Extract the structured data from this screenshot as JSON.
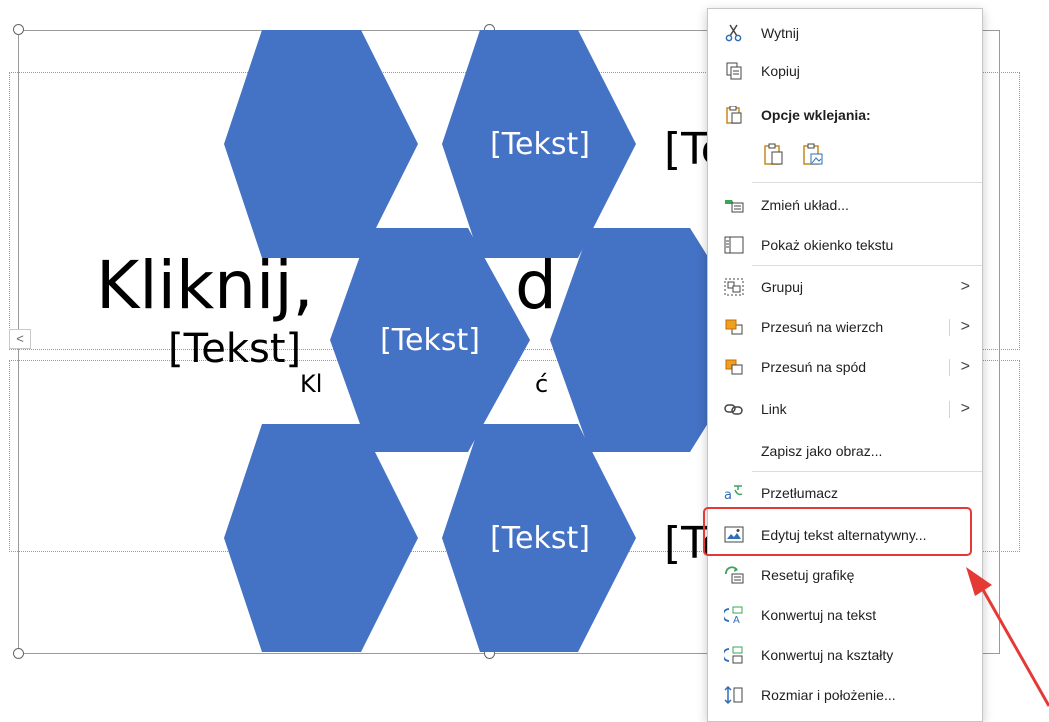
{
  "slide": {
    "title_text": "Kliknij,",
    "title_tail": "d",
    "subtitle_text": "Kl",
    "subtitle_tail": "ć",
    "smartart_labels": [
      "[Tekst]",
      "[Tekst]",
      "[Tekst]",
      "[Tekst]",
      "[Te",
      "[Te"
    ],
    "colors": {
      "hexagon_fill": "#4472C4",
      "hexagon_text": "#FFFFFF"
    }
  },
  "collapse_arrow": "<",
  "context_menu": {
    "items": {
      "cut": "Wytnij",
      "copy": "Kopiuj",
      "paste_options": "Opcje wklejania:",
      "change_layout": "Zmień układ...",
      "show_text_pane": "Pokaż okienko tekstu",
      "group": "Grupuj",
      "bring_to_front": "Przesuń na wierzch",
      "send_to_back": "Przesuń na spód",
      "link": "Link",
      "save_as_picture": "Zapisz jako obraz...",
      "translate": "Przetłumacz",
      "edit_alt_text": "Edytuj tekst alternatywny...",
      "reset_graphic": "Resetuj grafikę",
      "convert_to_text": "Konwertuj na tekst",
      "convert_to_shapes": "Konwertuj na kształty",
      "size_and_position": "Rozmiar i położenie..."
    },
    "submenu_glyph": ">",
    "highlighted_item": "Edytuj tekst alternatywny...",
    "colors": {
      "highlight": "#E53935",
      "arrow": "#E53935"
    }
  }
}
